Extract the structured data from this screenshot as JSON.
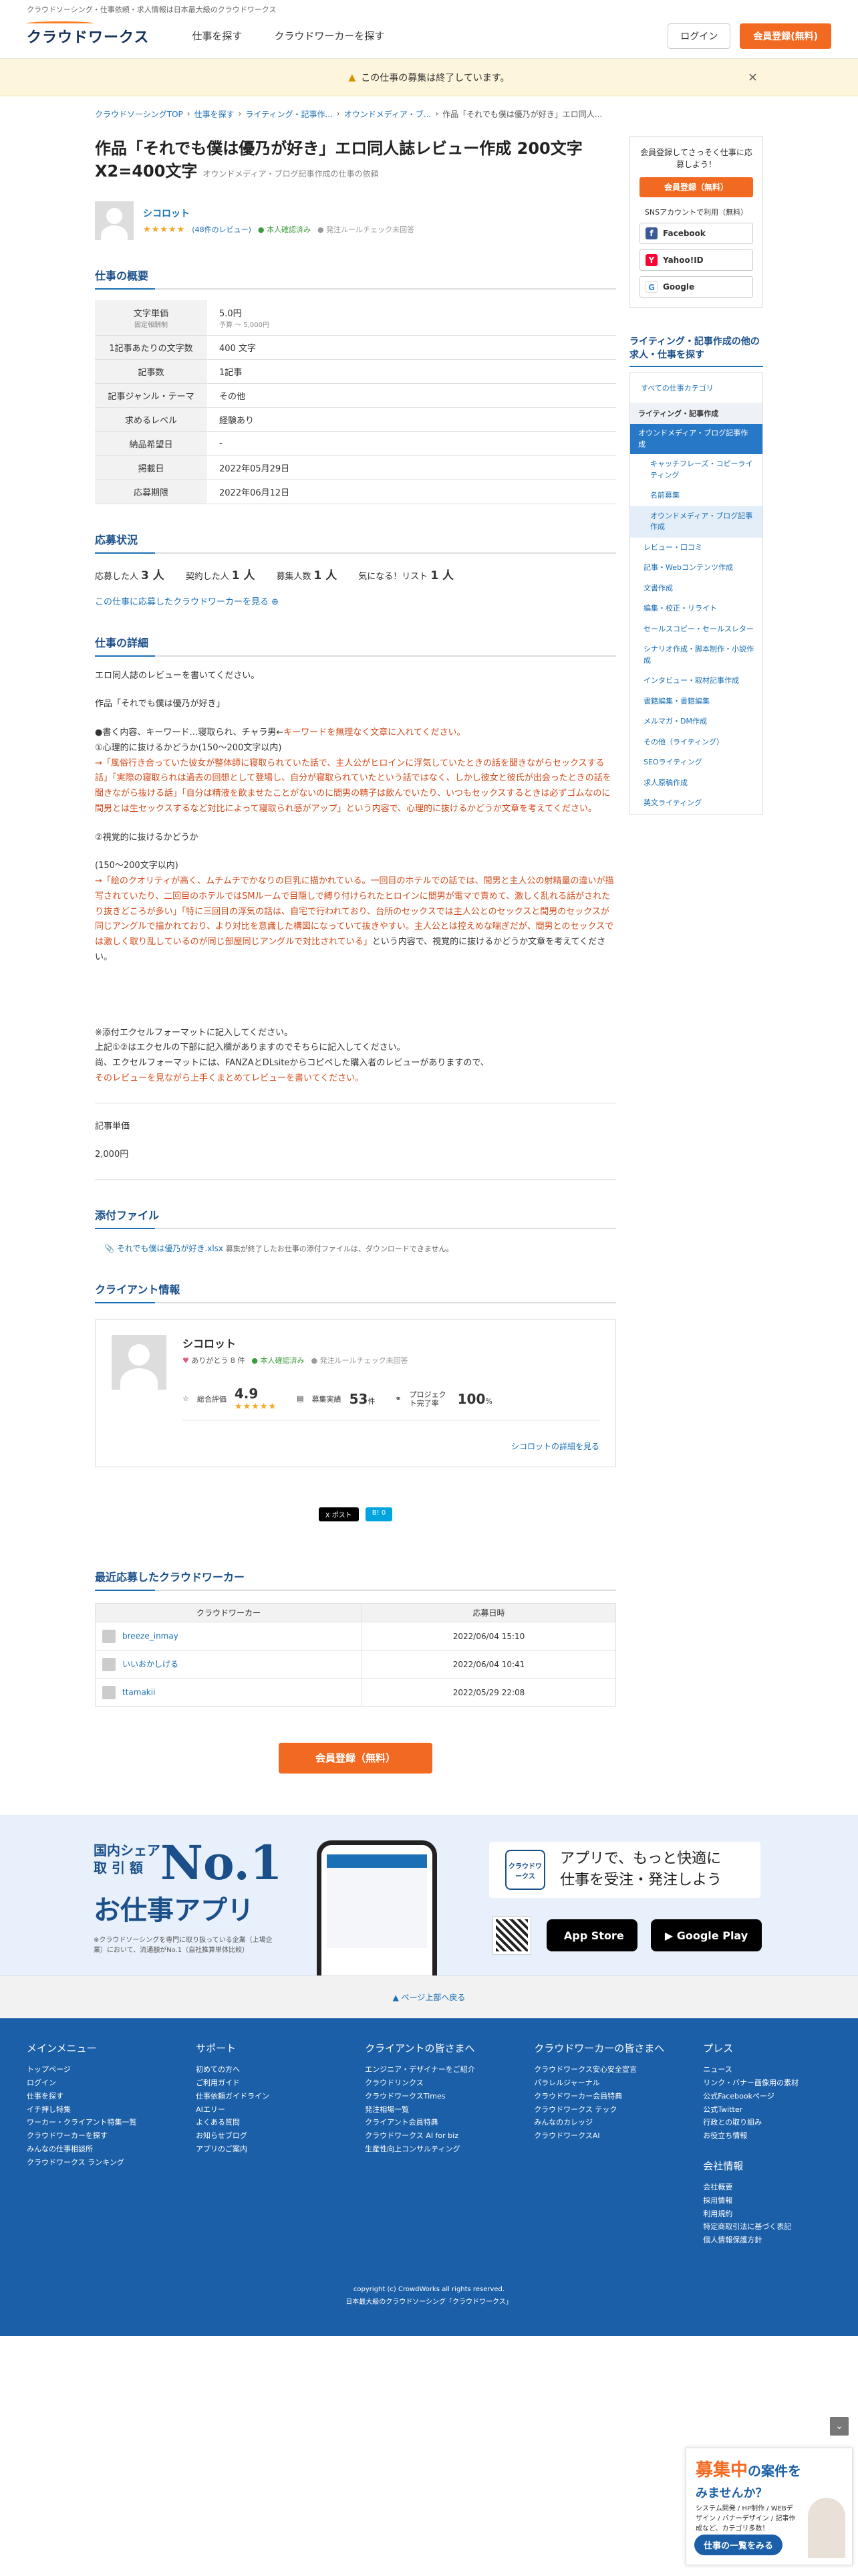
{
  "header": {
    "note": "クラウドソーシング・仕事依頼・求人情報は日本最大級のクラウドワークス",
    "logo": "クラウドワークス",
    "nav": [
      "仕事を探す",
      "クラウドワーカーを探す"
    ],
    "login": "ログイン",
    "register": "会員登録(無料)"
  },
  "notice": {
    "text": "この仕事の募集は終了しています。",
    "close": "×"
  },
  "breadcrumb": [
    "クラウドソーシングTOP",
    "仕事を探す",
    "ライティング・記事作...",
    "オウンドメディア・ブ...",
    "作品「それでも僕は優乃が好き」エロ同人..."
  ],
  "job": {
    "title": "作品「それでも僕は優乃が好き」エロ同人誌レビュー作成 200文字X2=400文字",
    "category": "オウンドメディア・ブログ記事作成の仕事の依頼",
    "client_name": "シコロット",
    "stars": "★★★★★",
    "reviews": "(48件のレビュー)",
    "verified": "本人確認済み",
    "ordering_rule": "発注ルールチェック未回答"
  },
  "summary": {
    "title": "仕事の概要",
    "rows": [
      {
        "label": "文字単価",
        "label_note": "固定報酬制",
        "value": "5.0円",
        "value_note": "予算 〜 5,000円"
      },
      {
        "label": "1記事あたりの文字数",
        "value": "400 文字"
      },
      {
        "label": "記事数",
        "value": "1記事"
      },
      {
        "label": "記事ジャンル・テーマ",
        "value": "その他"
      },
      {
        "label": "求めるレベル",
        "value": "経験あり"
      },
      {
        "label": "納品希望日",
        "value": "-"
      },
      {
        "label": "掲載日",
        "value": "2022年05月29日"
      },
      {
        "label": "応募期限",
        "value": "2022年06月12日"
      }
    ]
  },
  "applications": {
    "title": "応募状況",
    "applicants_label": "応募した人",
    "applicants": "3 人",
    "contracted_label": "契約した人",
    "contracted": "1 人",
    "recruit_label": "募集人数",
    "recruit": "1 人",
    "watch_label": "気になる！リスト",
    "watch": "1 人",
    "link": "この仕事に応募したクラウドワーカーを見る ⊕"
  },
  "detail": {
    "title": "仕事の詳細",
    "p1": "エロ同人誌のレビューを書いてください。",
    "p2": "作品「それでも僕は優乃が好き」",
    "p3a": "●書く内容、キーワード…寝取られ、チャラ男←",
    "p3b": "キーワードを無理なく文章に入れてください。",
    "p3c": "①心理的に抜けるかどうか(150〜200文字以内)",
    "p3d": "→「風俗行き合っていた彼女が整体師に寝取られていた話で、主人公がヒロインに浮気していたときの話を聞きながらセックスする話」「実際の寝取られは過去の回想として登場し、自分が寝取られていたという話ではなく、しかし彼女と彼氏が出会ったときの話を聞きながら抜ける話」「自分は精液を飲ませたことがないのに間男の精子は飲んでいたり、いつもセックスするときは必ずゴムなのに間男とは生セックスするなど対比によって寝取られ感がアップ」という内容で、心理的に抜けるかどうか文章を考えてください。",
    "p4": "②視覚的に抜けるかどうか",
    "p5a": "(150〜200文字以内)",
    "p5b": "→「絵のクオリティが高く、ムチムチでかなりの巨乳に描かれている。一回目のホテルでの話では、間男と主人公の射精量の違いが描写されていたり、二回目のホテルではSMルームで目隠しで縛り付けられたヒロインに間男が電マで責めて、激しく乱れる話がされたり抜きどころが多い」「特に三回目の浮気の話は、自宅で行われており、台所のセックスでは主人公とのセックスと間男のセックスが同じアングルで描かれており、より対比を意識した構図になっていて抜きやすい。主人公とは控えめな喘ぎだが、間男とのセックスでは激しく取り乱しているのが同じ部屋同じアングルで対比されている」",
    "p5c": "という内容で、視覚的に抜けるかどうか文章を考えてください。",
    "p6a": "※添付エクセルフォーマットに記入してください。",
    "p6b": "上記①②はエクセルの下部に記入欄がありますのでそちらに記入してください。",
    "p6c": "尚、エクセルフォーマットには、FANZAとDLsiteからコピペした購入者のレビューがありますので、",
    "p6d": "そのレビューを見ながら上手くまとめてレビューを書いてください。",
    "unit_label": "記事単価",
    "unit_value": "2,000円"
  },
  "attachment": {
    "title": "添付ファイル",
    "file": "それでも僕は優乃が好き.xlsx",
    "note": "募集が終了したお仕事の添付ファイルは、ダウンロードできません。"
  },
  "client_info": {
    "title": "クライアント情報",
    "name": "シコロット",
    "thanks": "ありがとう 8 件",
    "verified": "本人確認済み",
    "ordering_rule": "発注ルールチェック未回答",
    "rating_label": "総合評価",
    "rating": "4.9",
    "stars": "★★★★★",
    "posted_label": "募集実績",
    "posted": "53",
    "posted_unit": "件",
    "complete_label": "プロジェクト完了率",
    "complete": "100",
    "complete_unit": "%",
    "detail_link": "シコロットの詳細を見る"
  },
  "share": {
    "x": "X ポスト",
    "hatena": "B! 0"
  },
  "recent": {
    "title": "最近応募したクラウドワーカー",
    "col_worker": "クラウドワーカー",
    "col_date": "応募日時",
    "rows": [
      {
        "name": "breeze_inmay",
        "date": "2022/06/04 15:10"
      },
      {
        "name": "いいおかしげる",
        "date": "2022/06/04 10:41"
      },
      {
        "name": "ttamakii",
        "date": "2022/05/29 22:08"
      }
    ]
  },
  "cta": "会員登録（無料）",
  "sidebar": {
    "signup_text": "会員登録してさっそく仕事に応募しよう！",
    "signup_btn": "会員登録（無料）",
    "sns_text": "SNSアカウントで利用（無料）",
    "sns": [
      "Facebook",
      "Yahoo!ID",
      "Google"
    ],
    "cat_title": "ライティング・記事作成の他の求人・仕事を探す",
    "all": "すべての仕事カテゴリ",
    "head": "ライティング・記事作成",
    "selected": "オウンドメディア・ブログ記事作成",
    "items": [
      "キャッチフレーズ・コピーライティング",
      "名前募集",
      "オウンドメディア・ブログ記事作成"
    ],
    "items2": [
      "レビュー・口コミ",
      "記事・Webコンテンツ作成",
      "文書作成",
      "編集・校正・リライト",
      "セールスコピー・セールスレター",
      "シナリオ作成・脚本制作・小説作成",
      "インタビュー・取材記事作成",
      "書籍編集・書籍編集",
      "メルマガ・DM作成",
      "その他（ライティング）",
      "SEOライティング",
      "求人原稿作成",
      "英文ライティング"
    ]
  },
  "app_promo": {
    "share": "国内シェア\n取 引 額",
    "no1": "No.1",
    "title": "お仕事アプリ",
    "note": "※クラウドソーシングを専門に取り扱っている企業（上場企業）において、流通額がNo.1（自社推算単体比較）",
    "logo": "クラウドワークス",
    "headline": "アプリで、もっと快適に\n仕事を受注・発注しよう",
    "appstore": "App Store",
    "googleplay": "Google Play"
  },
  "footer": {
    "to_top": "▲ ページ上部へ戻る",
    "cols": [
      {
        "title": "メインメニュー",
        "items": [
          "トップページ",
          "ログイン",
          "仕事を探す",
          "イチ押し特集",
          "ワーカー・クライアント特集一覧",
          "クラウドワーカーを探す",
          "みんなの仕事相談所",
          "クラウドワークス ランキング"
        ]
      },
      {
        "title": "サポート",
        "items": [
          "初めての方へ",
          "ご利用ガイド",
          "仕事依頼ガイドライン",
          "AIエリー",
          "よくある質問",
          "お知らせブログ",
          "アプリのご案内"
        ]
      },
      {
        "title": "クライアントの皆さまへ",
        "items": [
          "エンジニア・デザイナーをご紹介",
          "クラウドリンクス",
          "クラウドワークスTimes",
          "発注相場一覧",
          "クライアント会員特典",
          "クラウドワークス AI for biz",
          "生産性向上コンサルティング"
        ]
      },
      {
        "title": "クラウドワーカーの皆さまへ",
        "items": [
          "クラウドワークス安心安全宣言",
          "パラレルジャーナル",
          "クラウドワーカー会員特典",
          "クラウドワークス テック",
          "みんなのカレッジ",
          "クラウドワークスAI"
        ]
      },
      {
        "title": "プレス",
        "items": [
          "ニュース",
          "リンク・バナー画像用の素材",
          "公式Facebookページ",
          "公式Twitter",
          "行政との取り組み",
          "お役立ち情報"
        ]
      }
    ],
    "company_title": "会社情報",
    "company_items": [
      "会社概要",
      "採用情報",
      "利用規約",
      "特定商取引法に基づく表記",
      "個人情報保護方針"
    ],
    "copyright": "copyright (c) CrowdWorks all rights reserved.",
    "tagline": "日本最大級のクラウドソーシング「クラウドワークス」"
  },
  "float_ad": {
    "title1": "募集中",
    "title2": "の案件を",
    "sub": "みませんか？",
    "note": "システム開発 / HP制作 / WEBデザイン / バナーデザイン / 記事作成など、カテゴリ多数！",
    "btn": "仕事の一覧をみる"
  }
}
